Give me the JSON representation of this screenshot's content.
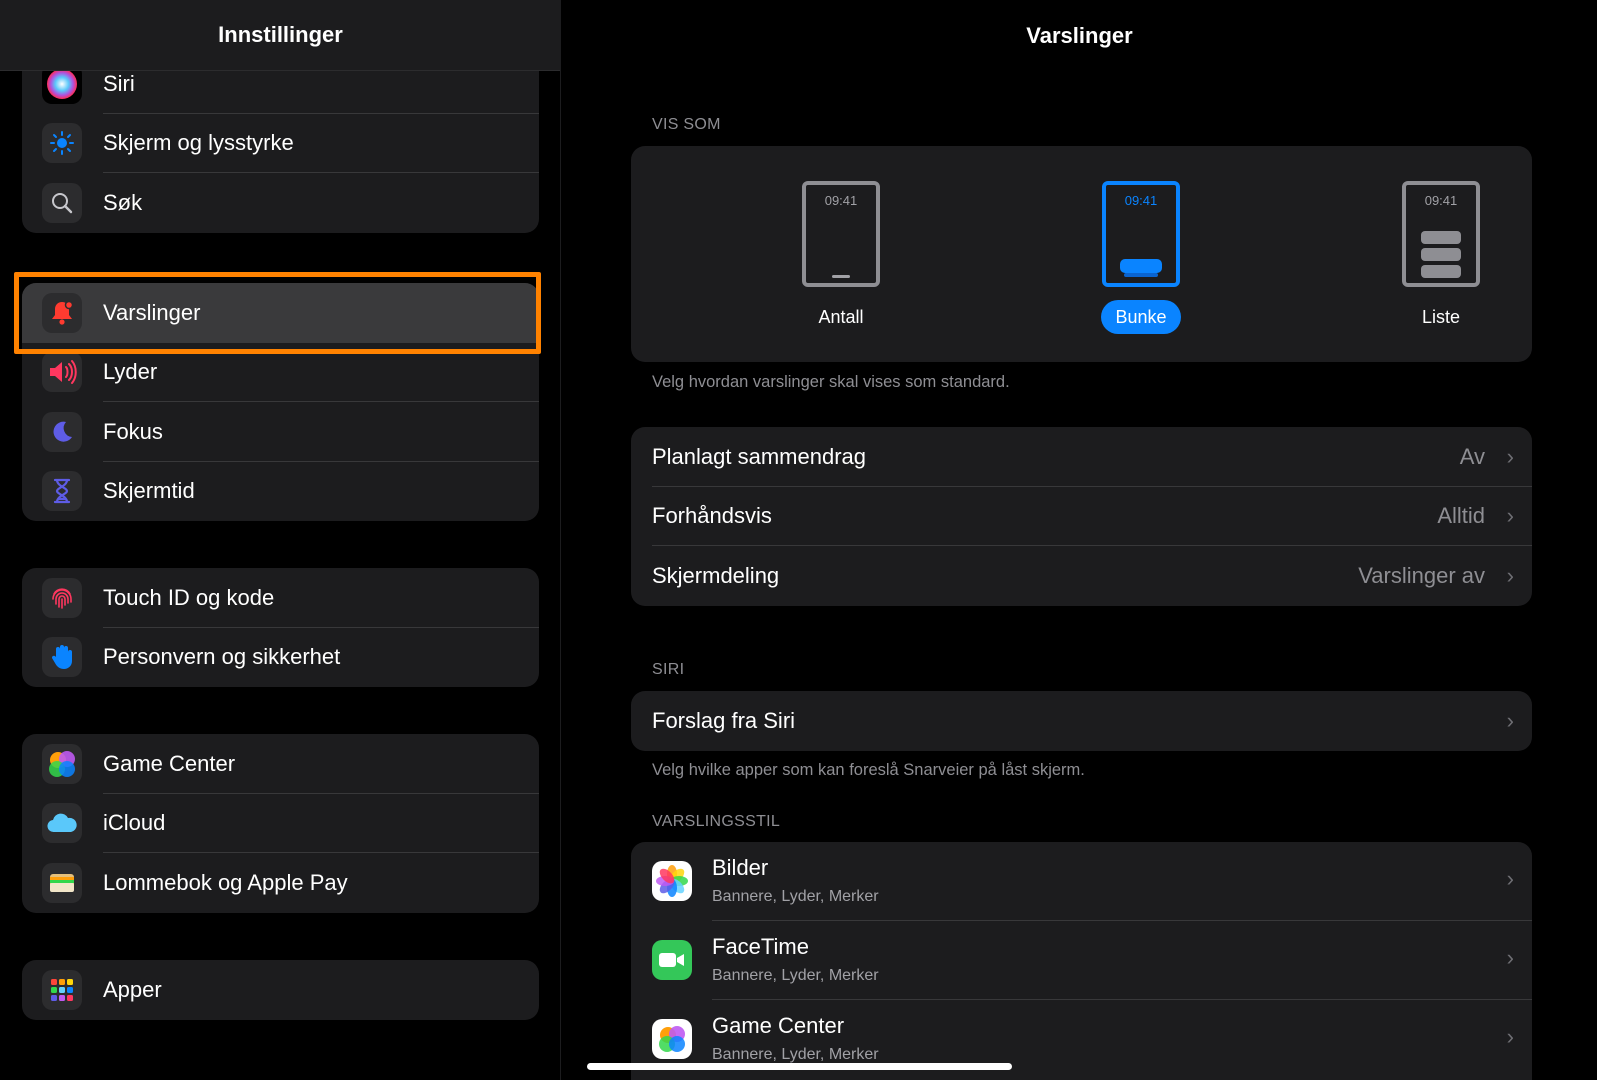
{
  "sidebar": {
    "title": "Innstillinger",
    "groups": [
      [
        {
          "label": "Siri",
          "icon": "siri-icon"
        },
        {
          "label": "Skjerm og lysstyrke",
          "icon": "sun-icon"
        },
        {
          "label": "Søk",
          "icon": "search-icon"
        }
      ],
      [
        {
          "label": "Varslinger",
          "icon": "bell-icon"
        },
        {
          "label": "Lyder",
          "icon": "speaker-icon"
        },
        {
          "label": "Fokus",
          "icon": "moon-icon"
        },
        {
          "label": "Skjermtid",
          "icon": "hourglass-icon"
        }
      ],
      [
        {
          "label": "Touch ID og kode",
          "icon": "fingerprint-icon"
        },
        {
          "label": "Personvern og sikkerhet",
          "icon": "hand-icon"
        }
      ],
      [
        {
          "label": "Game Center",
          "icon": "game-center-icon"
        },
        {
          "label": "iCloud",
          "icon": "cloud-icon"
        },
        {
          "label": "Lommebok og Apple Pay",
          "icon": "wallet-icon"
        }
      ],
      [
        {
          "label": "Apper",
          "icon": "apps-grid-icon"
        }
      ]
    ],
    "selected": "Varslinger"
  },
  "main": {
    "title": "Varslinger",
    "vis_som": {
      "section_label": "VIS SOM",
      "time": "09:41",
      "options": [
        {
          "label": "Antall"
        },
        {
          "label": "Bunke"
        },
        {
          "label": "Liste"
        }
      ],
      "selected": "Bunke",
      "footnote": "Velg hvordan varslinger skal vises som standard."
    },
    "settings": [
      {
        "label": "Planlagt sammendrag",
        "value": "Av"
      },
      {
        "label": "Forhåndsvis",
        "value": "Alltid"
      },
      {
        "label": "Skjermdeling",
        "value": "Varslinger av"
      }
    ],
    "siri": {
      "section_label": "SIRI",
      "row_label": "Forslag fra Siri",
      "footnote": "Velg hvilke apper som kan foreslå Snarveier på låst skjerm."
    },
    "varslingsstil": {
      "section_label": "VARSLINGSSTIL",
      "apps": [
        {
          "name": "Bilder",
          "sub": "Bannere, Lyder, Merker",
          "icon": "photos-icon"
        },
        {
          "name": "FaceTime",
          "sub": "Bannere, Lyder, Merker",
          "icon": "facetime-icon"
        },
        {
          "name": "Game Center",
          "sub": "Bannere, Lyder, Merker",
          "icon": "game-center-icon"
        }
      ]
    }
  },
  "colors": {
    "accent": "#0a84ff",
    "highlight": "#ff8200",
    "bell": "#ff3b30",
    "facetime": "#34c759"
  }
}
